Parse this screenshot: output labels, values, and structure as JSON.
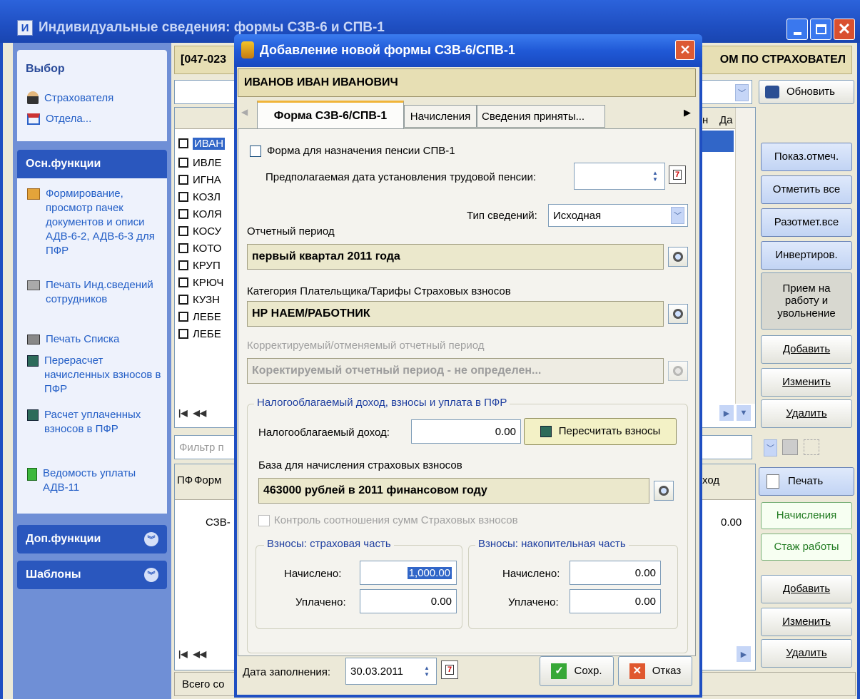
{
  "window": {
    "title": "Индивидуальные сведения: формы СЗВ-6 и СПВ-1"
  },
  "sidebar": {
    "section_vybor": "Выбор",
    "vybor_items": [
      {
        "label": "Страхователя"
      },
      {
        "label": "Отдела..."
      }
    ],
    "section_osn": "Осн.функции",
    "osn_items": [
      {
        "label": "Формирование, просмотр пачек документов и описи АДВ-6-2, АДВ-6-3 для ПФР"
      },
      {
        "label": "Печать Инд.сведений сотрудников"
      },
      {
        "label": "Печать Списка"
      },
      {
        "label": "Перерасчет начисленных взносов в ПФР"
      },
      {
        "label": "Расчет уплаченных взносов в ПФР"
      },
      {
        "label": "Ведомость уплаты АДВ-11"
      }
    ],
    "section_dop": "Доп.функции",
    "section_shabl": "Шаблоны"
  },
  "main": {
    "header_code": "[047-023",
    "header_right": "ОМ ПО СТРАХОВАТЕЛ",
    "employees": [
      "ИВАН",
      "ИВЛЕ",
      "ИГНА",
      "КОЗЛ",
      "КОЛЯ",
      "КОСУ",
      "КОТО",
      "КРУП",
      "КРЮЧ",
      "КУЗН",
      "ЛЕБЕ",
      "ЛЕБЕ"
    ],
    "col_n": "н",
    "col_da": "Да",
    "filter_placeholder": "Фильтр п",
    "bottom_col_pf": "ПФ",
    "bottom_col_form": "Форм",
    "bottom_col_dohod": "ход",
    "bottom_row_form": "СЗВ-",
    "bottom_row_sum": "0.00",
    "status_text": "Всего со"
  },
  "right_buttons": {
    "refresh": "Обновить",
    "show_marked": "Показ.отмеч.",
    "mark_all": "Отметить все",
    "unmark_all": "Разотмет.все",
    "invert": "Инвертиров.",
    "hire": "Прием на работу и увольнение",
    "add1": "Добавить",
    "edit1": "Изменить",
    "delete1": "Удалить",
    "print": "Печать",
    "accruals": "Начисления",
    "seniority": "Стаж работы",
    "add2": "Добавить",
    "edit2": "Изменить",
    "delete2": "Удалить"
  },
  "dialog": {
    "title": "Добавление новой формы СЗВ-6/СПВ-1",
    "person": "ИВАНОВ ИВАН ИВАНОВИЧ",
    "tabs": [
      {
        "label": "Форма СЗВ-6/СПВ-1"
      },
      {
        "label": "Начисления"
      },
      {
        "label": "Сведения приняты..."
      }
    ],
    "spv_checkbox": "Форма для назначения пенсии СПВ-1",
    "pension_date_label": "Предполагаемая дата установления трудовой пенсии:",
    "pension_date_value": "",
    "info_type_label": "Тип сведений:",
    "info_type_value": "Исходная",
    "period_label": "Отчетный период",
    "period_value": "первый квартал 2011 года",
    "category_label": "Категория Плательщика/Тарифы Страховых взносов",
    "category_value": "НР НАЕМ/РАБОТНИК",
    "corr_label": "Корректируемый/отменяемый отчетный период",
    "corr_value": "Коректируемый отчетный период - не определен...",
    "income_group_label": "Налогооблагаемый доход, взносы и уплата в ПФР",
    "taxable_income_label": "Налогооблагаемый доход:",
    "taxable_income_value": "0.00",
    "recalc_button": "Пересчитать взносы",
    "base_label": "База для начисления страховых взносов",
    "base_value": "463000 рублей в 2011 финансовом году",
    "control_checkbox": "Контроль соотношения сумм Страховых взносов",
    "insurance_group": "Взносы: страховая часть",
    "savings_group": "Взносы: накопительная часть",
    "accrued_label": "Начислено:",
    "paid_label": "Уплачено:",
    "ins_accrued": "1,000.00",
    "ins_paid": "0.00",
    "sav_accrued": "0.00",
    "sav_paid": "0.00",
    "fill_date_label": "Дата заполнения:",
    "fill_date_value": "30.03.2011",
    "save_button": "Сохр.",
    "cancel_button": "Отказ"
  }
}
